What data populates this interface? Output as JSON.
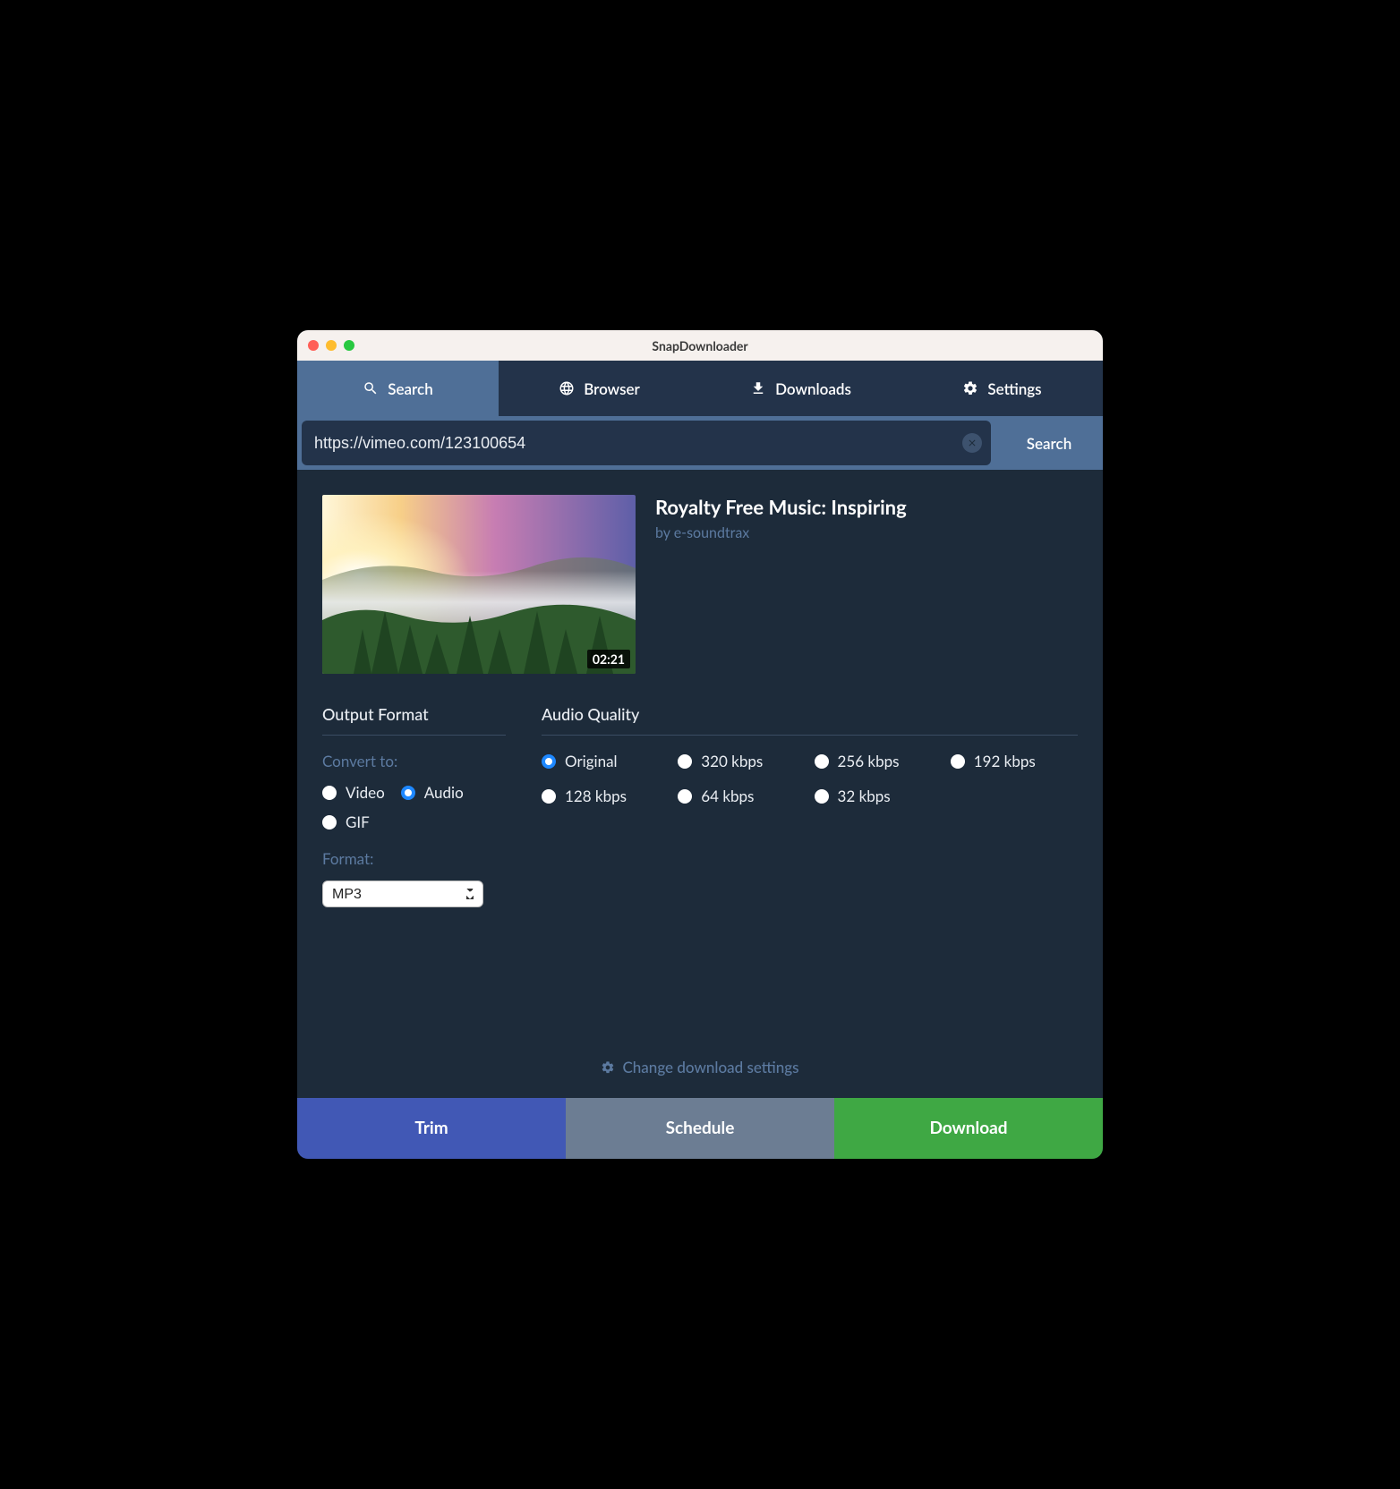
{
  "window": {
    "title": "SnapDownloader"
  },
  "tabs": {
    "search": "Search",
    "browser": "Browser",
    "downloads": "Downloads",
    "settings": "Settings"
  },
  "search": {
    "url": "https://vimeo.com/123100654",
    "button": "Search"
  },
  "video": {
    "title": "Royalty Free Music: Inspiring",
    "author": "by e-soundtrax",
    "duration": "02:21"
  },
  "output": {
    "section_title": "Output Format",
    "convert_label": "Convert to:",
    "options": {
      "video": "Video",
      "audio": "Audio",
      "gif": "GIF"
    },
    "selected": "audio",
    "format_label": "Format:",
    "format_value": "MP3"
  },
  "quality": {
    "section_title": "Audio Quality",
    "selected": "Original",
    "options": [
      "Original",
      "320 kbps",
      "256 kbps",
      "192 kbps",
      "128 kbps",
      "64 kbps",
      "32 kbps"
    ]
  },
  "change_settings": "Change download settings",
  "footer": {
    "trim": "Trim",
    "schedule": "Schedule",
    "download": "Download"
  }
}
